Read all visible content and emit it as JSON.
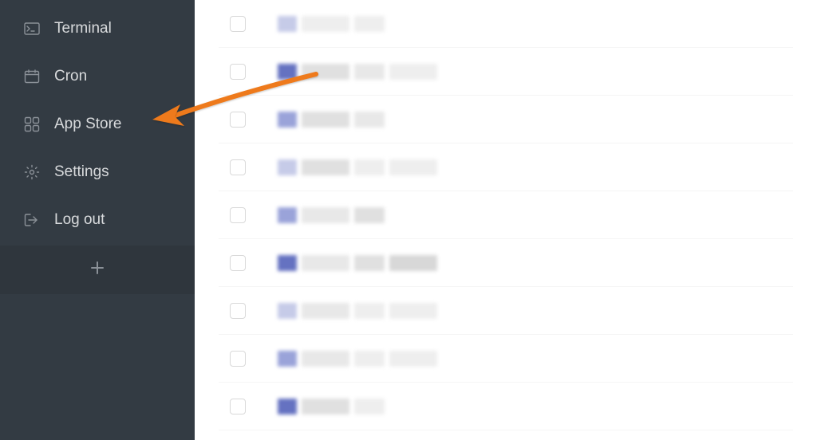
{
  "sidebar": {
    "items": [
      {
        "label": "Terminal",
        "icon": "terminal-icon"
      },
      {
        "label": "Cron",
        "icon": "calendar-icon"
      },
      {
        "label": "App Store",
        "icon": "apps-icon"
      },
      {
        "label": "Settings",
        "icon": "gear-icon"
      },
      {
        "label": "Log out",
        "icon": "logout-icon"
      }
    ]
  },
  "main": {
    "rows": [
      {
        "checked": false,
        "iconShade": "c-light",
        "bars": [
          "c-grey4",
          "c-grey4"
        ]
      },
      {
        "checked": false,
        "iconShade": "c-darker",
        "bars": [
          "c-grey2",
          "c-grey1",
          "c-grey4"
        ]
      },
      {
        "checked": false,
        "iconShade": "c-mid",
        "bars": [
          "c-grey2",
          "c-grey1"
        ]
      },
      {
        "checked": false,
        "iconShade": "c-light",
        "bars": [
          "c-grey2",
          "c-grey4",
          "c-grey4"
        ]
      },
      {
        "checked": false,
        "iconShade": "c-mid",
        "bars": [
          "c-grey1",
          "c-grey2"
        ]
      },
      {
        "checked": false,
        "iconShade": "c-darker",
        "bars": [
          "c-grey1",
          "c-grey2",
          "c-grey3"
        ]
      },
      {
        "checked": false,
        "iconShade": "c-light",
        "bars": [
          "c-grey1",
          "c-grey4",
          "c-grey4"
        ]
      },
      {
        "checked": false,
        "iconShade": "c-mid",
        "bars": [
          "c-grey1",
          "c-grey4",
          "c-grey4"
        ]
      },
      {
        "checked": false,
        "iconShade": "c-darker",
        "bars": [
          "c-grey2",
          "c-grey4"
        ]
      }
    ]
  },
  "annotation": {
    "type": "arrow",
    "color": "#ee7a1a",
    "pointsTo": "sidebar-item-app-store"
  }
}
